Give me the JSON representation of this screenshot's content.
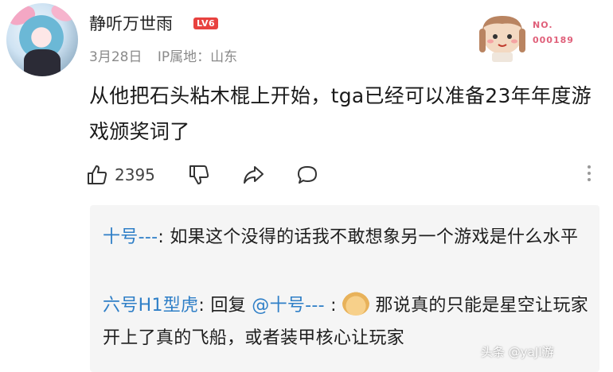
{
  "comment": {
    "username": "静听万世雨",
    "level_badge": "LV6",
    "date": "3月28日",
    "ip_location": "IP属地：山东",
    "decor_label": "NO.",
    "decor_number": "000189",
    "text": "从他把石头粘木棍上开始，tga已经可以准备23年年度游戏颁奖词了",
    "like_count": "2395"
  },
  "replies": [
    {
      "name": "十号---",
      "separator": ": ",
      "text": "如果这个没得的话我不敢想象另一个游戏是什么水平"
    },
    {
      "name": "六号H1型虎",
      "separator": ": ",
      "reply_prefix": "回复 ",
      "reply_target": "@十号---",
      "reply_sep": " : ",
      "text": "那说真的只能是星空让玩家开上了真的飞船，或者装甲核心让玩家"
    }
  ],
  "watermark": "头条 @yaJI游"
}
